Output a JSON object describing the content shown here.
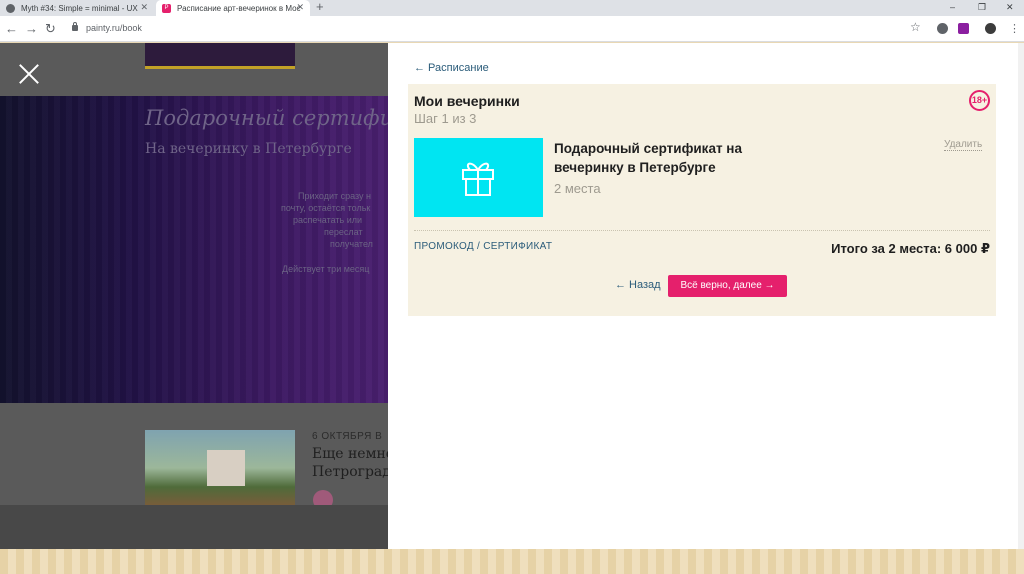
{
  "browser": {
    "tabs": [
      {
        "title": "Myth #34: Simple = minimal - UX"
      },
      {
        "title": "Расписание арт-вечеринок в Мос",
        "favicon": "P"
      }
    ],
    "url": "painty.ru/book"
  },
  "background_page": {
    "hero_title": "Подарочный сертифи",
    "hero_subtitle": "На вечеринку в Петербурге",
    "hero_lines": [
      "Приходит сразу н",
      "почту, остаётся тольк",
      "распечатать или",
      "переслат",
      "получател",
      "Действует три месяц"
    ],
    "event_date": "6 ОКТЯБРЯ В",
    "event_title_1": "Еще немно",
    "event_title_2": "Петроград"
  },
  "panel": {
    "back_link": "← Расписание",
    "title": "Мои вечеринки",
    "step": "Шаг 1 из 3",
    "age_badge": "18+",
    "item": {
      "name": "Подарочный сертификат на вечеринку в Петербурге",
      "quantity": "2 места",
      "remove_label": "Удалить",
      "image_icon": "gift-icon",
      "image_color": "#00e5f2"
    },
    "promo_label": "ПРОМОКОД / СЕРТИФИКАТ",
    "total": "Итого за 2 места: 6 000 ₽",
    "back_button": "← Назад",
    "next_button": "Всё верно, далее →"
  },
  "colors": {
    "accent": "#e5206c",
    "link": "#2b5c7a",
    "card_bg": "#f6f1e2"
  }
}
